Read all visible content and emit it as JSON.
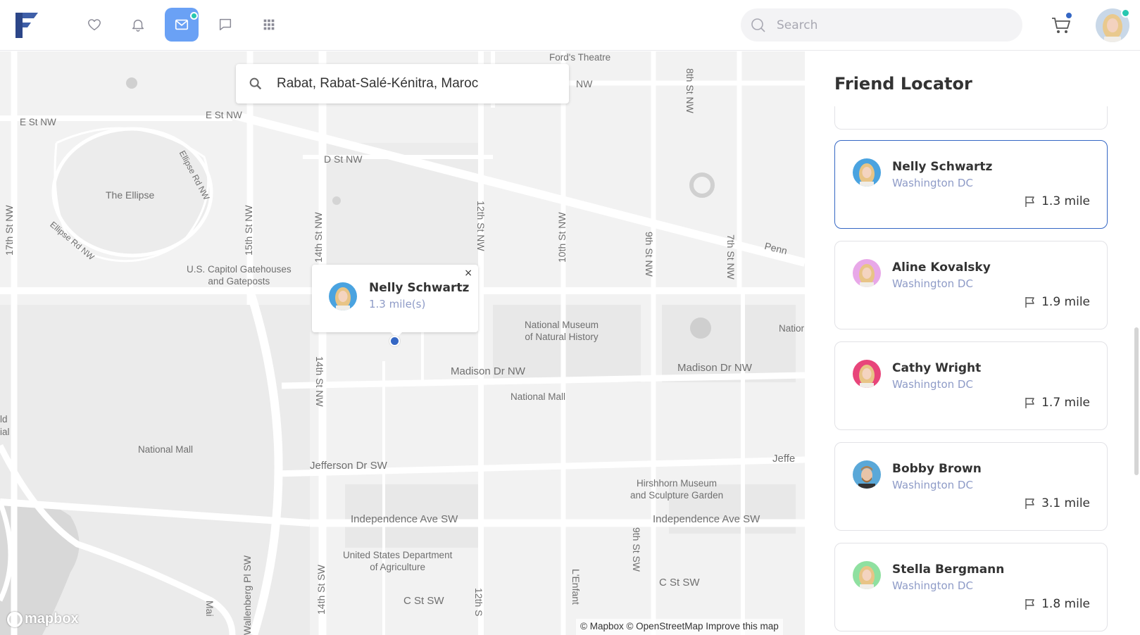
{
  "topbar": {
    "search_placeholder": "Search",
    "nav": [
      {
        "name": "favorites",
        "icon": "heart-icon"
      },
      {
        "name": "notifications",
        "icon": "bell-icon"
      },
      {
        "name": "messages",
        "icon": "mail-icon",
        "active": true,
        "badge": true
      },
      {
        "name": "chat",
        "icon": "chat-icon"
      },
      {
        "name": "apps",
        "icon": "grid-icon"
      }
    ],
    "accent_color": "#6aa1f5",
    "badge_color": "#28c7b0",
    "cart_badge_color": "#3567c4"
  },
  "map": {
    "search_value": "Rabat, Rabat-Salé-Kénitra, Maroc",
    "popup": {
      "name": "Nelly Schwartz",
      "distance": "1.3 mile(s)",
      "close": "×"
    },
    "labels": {
      "fords_theatre": "Ford's Theatre",
      "nw_top": "NW",
      "e_st_nw_left": "E St NW",
      "e_st_nw_mid": "E St NW",
      "d_st_nw": "D St NW",
      "ellipse": "The Ellipse",
      "ellipse_rd_1": "Ellipse Rd NW",
      "ellipse_rd_2": "Ellipse Rd NW",
      "gatehouses": "U.S. Capitol Gatehouses\nand Gateposts",
      "st17": "17th St NW",
      "st15": "15th St NW",
      "st14_top": "14th St NW",
      "st14_mid": "14th St NW",
      "st14_sw": "14th St SW",
      "st12": "12th St NW",
      "st12_sw": "12th S",
      "st10": "10th St NW",
      "st9": "9th St NW",
      "st9_sw": "9th St SW",
      "st8": "8th St NW",
      "st7": "7th St NW",
      "penn": "Penn",
      "museum_nh": "National Museum\nof Natural History",
      "nation": "Natior",
      "madison_1": "Madison Dr NW",
      "madison_2": "Madison Dr NW",
      "national_mall_1": "National Mall",
      "national_mall_2": "National Mall",
      "jefferson": "Jefferson Dr SW",
      "jefferson_2": "Jeffe",
      "hirshhorn": "Hirshhorn Museum\nand Sculpture Garden",
      "independence_1": "Independence Ave SW",
      "independence_2": "Independence Ave SW",
      "usda": "United States Department\nof Agriculture",
      "wallenberg": "Wallenberg Pl SW",
      "enfant": "L'Enfant",
      "c_st_sw_1": "C St SW",
      "c_st_sw_2": "C St SW",
      "edge_ld": "ld",
      "edge_ial": "ial",
      "mai": "Mai"
    },
    "mapbox_logo": "mapbox",
    "attribution": "© Mapbox © OpenStreetMap Improve this map"
  },
  "panel": {
    "title": "Friend Locator",
    "friends": [
      {
        "name": "Nelly Schwartz",
        "location": "Washington DC",
        "distance": "1.3 mile",
        "active": true,
        "avatar_bg": "#4aa3e0"
      },
      {
        "name": "Aline Kovalsky",
        "location": "Washington DC",
        "distance": "1.9 mile",
        "active": false,
        "avatar_bg": "#e8a8e8"
      },
      {
        "name": "Cathy Wright",
        "location": "Washington DC",
        "distance": "1.7 mile",
        "active": false,
        "avatar_bg": "#e8457a"
      },
      {
        "name": "Bobby Brown",
        "location": "Washington DC",
        "distance": "3.1 mile",
        "active": false,
        "avatar_bg": "#5aa8d8"
      },
      {
        "name": "Stella Bergmann",
        "location": "Washington DC",
        "distance": "1.8 mile",
        "active": false,
        "avatar_bg": "#8fe0a0"
      }
    ]
  }
}
